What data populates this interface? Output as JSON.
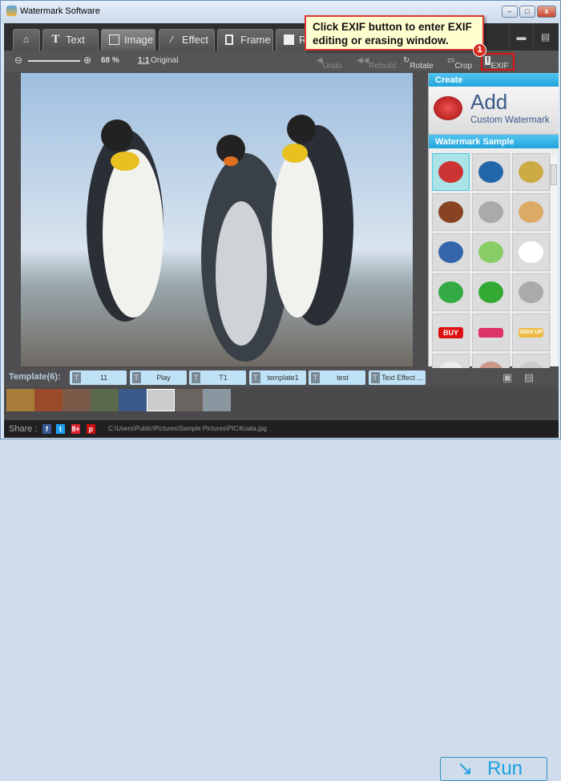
{
  "window": {
    "title": "Watermark Software",
    "min": "–",
    "max": "□",
    "close": "x"
  },
  "tabs": [
    {
      "label": "",
      "icon": "home-icon"
    },
    {
      "label": "Text",
      "icon": "text-icon"
    },
    {
      "label": "Image",
      "icon": "image-icon",
      "active": true
    },
    {
      "label": "Effect",
      "icon": "magic-wand-icon"
    },
    {
      "label": "Frame",
      "icon": "frame-icon"
    },
    {
      "label": "Re",
      "icon": "resize-icon"
    }
  ],
  "toolbar": {
    "zoom": "68 %",
    "original": "Original",
    "original_icon": "1:1",
    "undo": "Undo",
    "rebuild": "Rebuild",
    "rotate": "Rotate",
    "crop": "Crop",
    "exif": "EXIF"
  },
  "callout": {
    "text": "Click EXIF button to enter EXIF editing or erasing window.",
    "step": "1"
  },
  "right_panel": {
    "create": "Create",
    "add": "Add",
    "add_sub": "Custom Watermark",
    "sample": "Watermark Sample",
    "samples": [
      "pie-chart-3d",
      "pie-chart-blue",
      "hanging-tags",
      "server-rack",
      "shopping-cart-add",
      "open-box",
      "blue-tag",
      "pie-chart-pastel",
      "email-envelope",
      "door-hangers-sale",
      "shopping-basket",
      "database-arrow",
      "buy-button",
      "pink-button",
      "sign-up-button",
      "cartoon",
      "hand",
      "eye"
    ],
    "buy": "BUY",
    "signup": "SIGN UP"
  },
  "templates": {
    "label": "Template(6):",
    "items": [
      "11",
      "Play",
      "T1",
      "template1",
      "test",
      "Text Effect ..."
    ]
  },
  "thumbnails": [
    "autumn-tree",
    "red-texture",
    "desert",
    "flower",
    "jellyfish",
    "koala",
    "lighthouse",
    "penguins"
  ],
  "run": "Run",
  "share": {
    "label": "Share :",
    "path": "C:\\Users\\Public\\Pictures\\Sample Pictures\\PIC\\Koala.jpg",
    "icons": [
      "f",
      "t",
      "8+",
      "p"
    ]
  },
  "colors": {
    "accent": "#21a5dc",
    "callout_border": "#dd3333",
    "callout_bg": "#ffffd0"
  }
}
